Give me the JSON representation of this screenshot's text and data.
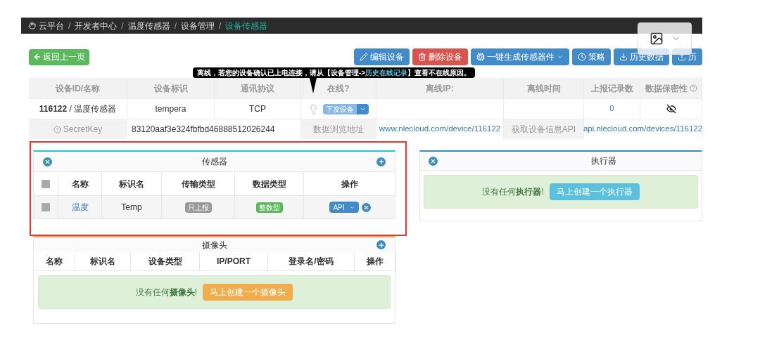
{
  "breadcrumb": [
    {
      "kind": "home",
      "label": "云平台",
      "selected": false
    },
    {
      "kind": "separator",
      "label": "/"
    },
    {
      "kind": "item",
      "label": "开发者中心",
      "selected": false
    },
    {
      "kind": "separator",
      "label": "/"
    },
    {
      "kind": "item",
      "label": "温度传感器",
      "selected": false
    },
    {
      "kind": "separator",
      "label": "/"
    },
    {
      "kind": "item",
      "label": "设备管理",
      "selected": false
    },
    {
      "kind": "separator",
      "label": "/"
    },
    {
      "kind": "item",
      "label": "设备传感器",
      "selected": true
    }
  ],
  "back_button": {
    "label": "返回上一页"
  },
  "actions": [
    {
      "kind": "edit",
      "label": "编辑设备",
      "color": "#428bca"
    },
    {
      "kind": "delete",
      "label": "删除设备",
      "color": "#d9534f"
    },
    {
      "kind": "generate",
      "label": "一键生成传感器件",
      "color": "#428bca",
      "dropdown": true
    },
    {
      "kind": "strategy",
      "label": "策略",
      "color": "#428bca"
    },
    {
      "kind": "history",
      "label": "历史数据",
      "color": "#428bca"
    },
    {
      "kind": "upload",
      "label": "历",
      "color": "#428bca"
    }
  ],
  "tooltip": {
    "text": "离线，若您的设备确认已上电连接，请从【设备管理->",
    "link": "历史在线记录",
    "text_after": "】查看不在线原因。"
  },
  "device_table": {
    "columns": [
      {
        "label": "设备ID/名称"
      },
      {
        "label": "设备标识"
      },
      {
        "label": "通讯协议"
      },
      {
        "label": "在线?"
      },
      {
        "label": "离线IP:"
      },
      {
        "label": "离线时间"
      },
      {
        "label": "上报记录数"
      },
      {
        "label": "数据保密性",
        "help": true
      }
    ],
    "rows": [
      [
        {
          "kind": "id_name",
          "id": "116122",
          "separator": "/",
          "name": "温度传感器"
        },
        {
          "kind": "text",
          "text": "tempera"
        },
        {
          "kind": "text",
          "text": "TCP"
        },
        {
          "kind": "online",
          "online": false,
          "button": "下发设备"
        },
        {
          "kind": "empty"
        },
        {
          "kind": "empty"
        },
        {
          "kind": "link",
          "text": "0"
        },
        {
          "kind": "eye"
        }
      ]
    ]
  },
  "device_info": [
    {
      "label": "SecretKey",
      "help": true,
      "kind": "text",
      "value": "83120aaf3e324fbfbd46888512026244"
    },
    {
      "label": "数据浏览地址",
      "help": false,
      "kind": "link",
      "value": "www.nlecloud.com/device/116122"
    },
    {
      "label": "获取设备信息API",
      "help": false,
      "kind": "link",
      "value": "api.nlecloud.com/devices/116122"
    }
  ],
  "sensor_panel": {
    "title": "传感器",
    "columns": [
      {
        "kind": "checkbox",
        "checked": false
      },
      {
        "kind": "text",
        "label": "名称"
      },
      {
        "kind": "text",
        "label": "标识名"
      },
      {
        "kind": "text",
        "label": "传输类型"
      },
      {
        "kind": "text",
        "label": "数据类型"
      },
      {
        "kind": "text",
        "label": "操作"
      }
    ],
    "rows": [
      {
        "checked": false,
        "name": "温度",
        "identifier": "Temp",
        "transfer": "只上报",
        "data_type": "整数型",
        "action": "API"
      }
    ]
  },
  "actuator_panel": {
    "title": "执行器",
    "empty_message": "没有任何**执行器**!",
    "create_button": "马上创建一个执行器"
  },
  "camera_panel": {
    "title": "摄像头",
    "columns": [
      "名称",
      "标识名",
      "设备类型",
      "IP/PORT",
      "登录名/密码",
      "操作"
    ],
    "empty_message": "没有任何**摄像头**!",
    "create_button": "马上创建一个摄像头"
  }
}
